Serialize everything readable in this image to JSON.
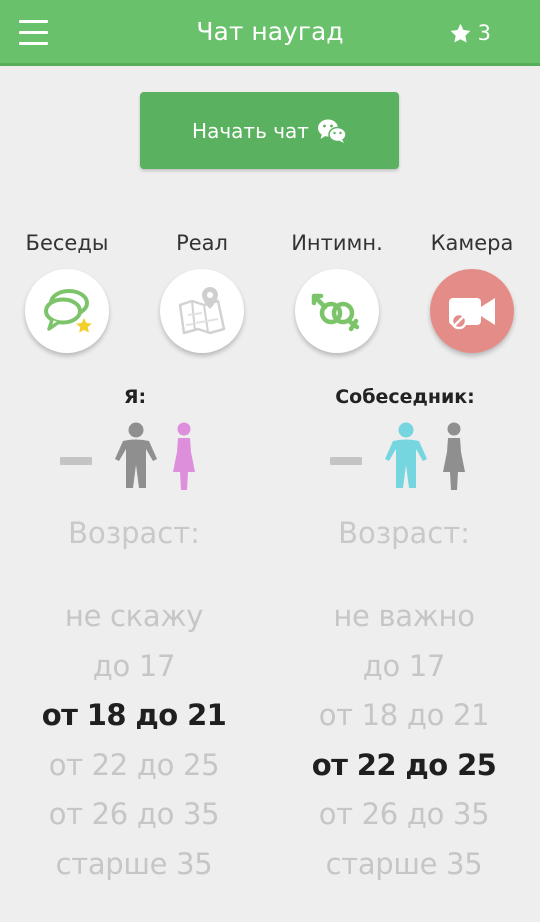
{
  "header": {
    "title": "Чат наугад",
    "stars": "3",
    "bg": "#69c16b"
  },
  "start_button": {
    "label": "Начать чат"
  },
  "modes": [
    {
      "label": "Беседы",
      "icon": "chat-bubbles-star-icon"
    },
    {
      "label": "Реал",
      "icon": "map-pin-icon"
    },
    {
      "label": "Интимн.",
      "icon": "gender-symbols-icon"
    },
    {
      "label": "Камера",
      "icon": "video-camera-disabled-icon"
    }
  ],
  "me": {
    "heading": "Я:",
    "selected_gender": "none",
    "age_title": "Возраст:",
    "ages": [
      "не скажу",
      "до 17",
      "от 18 до 21",
      "от 22 до 25",
      "от 26 до 35",
      "старше 35"
    ],
    "selected_age": "от 18 до 21"
  },
  "partner": {
    "heading": "Собеседник:",
    "selected_gender": "male",
    "age_title": "Возраст:",
    "ages": [
      "не важно",
      "до 17",
      "от 18 до 21",
      "от 22 до 25",
      "от 26 до 35",
      "старше 35"
    ],
    "selected_age": "от 22 до 25"
  },
  "colors": {
    "male_active": "#76d6e0",
    "female_active": "#de8fdc",
    "inactive": "#8f8f8f"
  }
}
